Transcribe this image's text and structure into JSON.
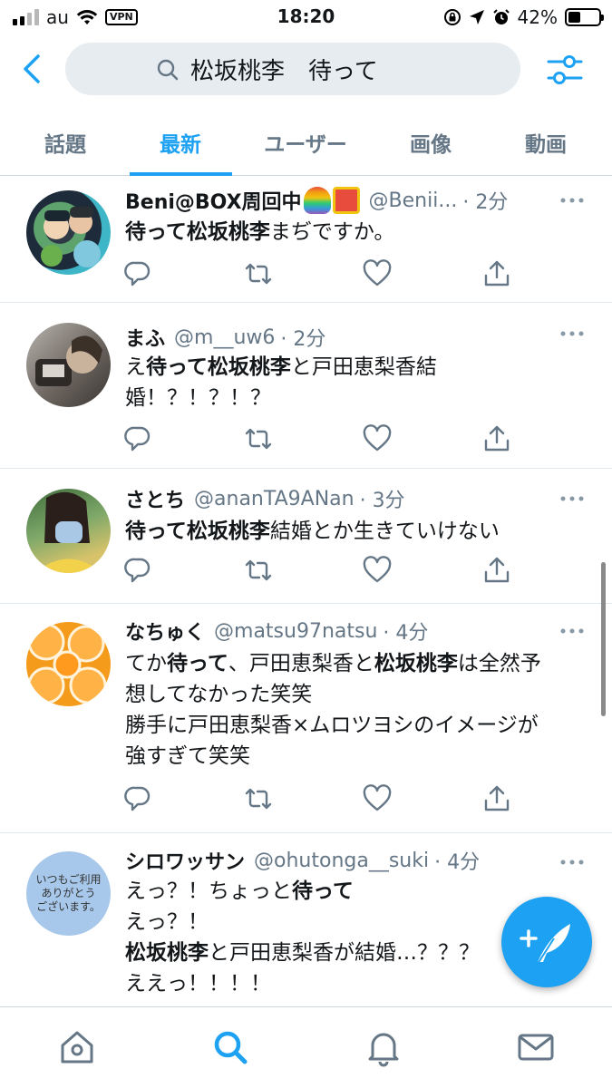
{
  "status_bar": {
    "carrier": "au",
    "vpn": "VPN",
    "time": "18:20",
    "battery": "42%",
    "battery_level": 0.42
  },
  "search": {
    "query": "松坂桃李　待って"
  },
  "tabs": [
    {
      "label": "話題"
    },
    {
      "label": "最新"
    },
    {
      "label": "ユーザー"
    },
    {
      "label": "画像"
    },
    {
      "label": "動画"
    }
  ],
  "active_tab": "最新",
  "tweets": [
    {
      "name": "Beni@BOX周回中",
      "handle": "@Benii...",
      "time": "· 2分",
      "lines": [
        [
          {
            "t": "待って松坂桃李",
            "b": true
          },
          {
            "t": "まぢですか。",
            "b": false
          }
        ]
      ]
    },
    {
      "name": "まふ",
      "handle": "@m__uw6",
      "time": "· 2分",
      "lines": [
        [
          {
            "t": "え",
            "b": false
          },
          {
            "t": "待って松坂桃李",
            "b": true
          },
          {
            "t": "と戸田恵梨香結",
            "b": false
          }
        ],
        [
          {
            "t": "婚！？！？！？",
            "b": false
          }
        ]
      ]
    },
    {
      "name": "さとち",
      "handle": "@ananTA9ANan",
      "time": "· 3分",
      "lines": [
        [
          {
            "t": "待って松坂桃李",
            "b": true
          },
          {
            "t": "結婚とか生きていけない",
            "b": false
          }
        ]
      ]
    },
    {
      "name": "なちゅく",
      "handle": "@matsu97natsu",
      "time": "· 4分",
      "lines": [
        [
          {
            "t": "てか",
            "b": false
          },
          {
            "t": "待って",
            "b": true
          },
          {
            "t": "、戸田恵梨香と",
            "b": false
          },
          {
            "t": "松坂桃李",
            "b": true
          },
          {
            "t": "は全然予",
            "b": false
          }
        ],
        [
          {
            "t": "想してなかった笑笑",
            "b": false
          }
        ],
        [
          {
            "t": "勝手に戸田恵梨香×ムロツヨシのイメージが",
            "b": false
          }
        ],
        [
          {
            "t": "強すぎて笑笑",
            "b": false
          }
        ]
      ]
    },
    {
      "name": "シロワッサン",
      "handle": "@ohutonga__suki",
      "time": "· 4分",
      "avatar_text": [
        "いつもご利用",
        "ありがとう",
        "ございます。"
      ],
      "lines": [
        [
          {
            "t": "えっ？！ちょっと",
            "b": false
          },
          {
            "t": "待って",
            "b": true
          }
        ],
        [
          {
            "t": "えっ？！",
            "b": false
          }
        ],
        [
          {
            "t": "松坂桃李",
            "b": true
          },
          {
            "t": "と戸田恵梨香が結婚…？？？",
            "b": false
          }
        ],
        [
          {
            "t": "ええっ！！！！",
            "b": false
          }
        ]
      ]
    }
  ],
  "colors": {
    "accent": "#1da1f2",
    "secondary_text": "#657786",
    "search_bg": "#e6ecf0",
    "divider": "#e1e8ed"
  },
  "icons": {
    "back": "chevron-left-icon",
    "search": "search-icon",
    "filter": "sliders-icon",
    "reply": "reply-icon",
    "retweet": "retweet-icon",
    "like": "heart-icon",
    "share": "share-icon",
    "compose": "compose-tweet-icon",
    "nav": [
      "home-icon",
      "search-icon",
      "notifications-icon",
      "messages-icon"
    ]
  }
}
